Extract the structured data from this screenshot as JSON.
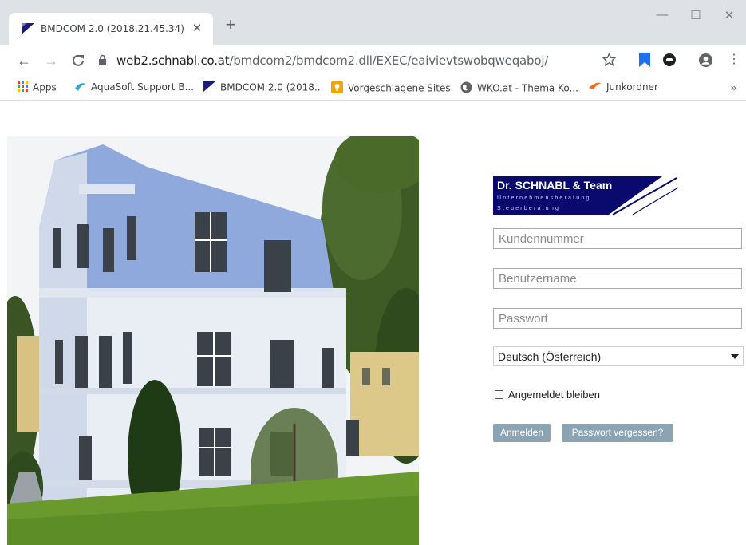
{
  "browser": {
    "tab_title": "BMDCOM 2.0 (2018.21.45.34)",
    "url_host": "web2.schnabl.co.at",
    "url_path": "/bmdcom2/bmdcom2.dll/EXEC/eaivievtswobqweqaboj/",
    "bookmarks": [
      {
        "label": "Apps",
        "icon": "apps-grid-icon"
      },
      {
        "label": "AquaSoft Support B...",
        "icon": "aquasoft-icon"
      },
      {
        "label": "BMDCOM 2.0 (2018...",
        "icon": "bmd-icon"
      },
      {
        "label": "Vorgeschlagene Sites",
        "icon": "suggested-sites-icon"
      },
      {
        "label": "WKO.at - Thema Ko...",
        "icon": "globe-icon"
      },
      {
        "label": "Junkordner",
        "icon": "junkordner-icon"
      }
    ],
    "overflow_label": "»"
  },
  "logo": {
    "title": "Dr. SCHNABL & Team",
    "line1": "Unternehmensberatung",
    "line2": "Steuerberatung",
    "color": "#0a0a6e"
  },
  "login": {
    "customer_placeholder": "Kundennummer",
    "user_placeholder": "Benutzername",
    "password_placeholder": "Passwort",
    "language": "Deutsch (Österreich)",
    "remember_label": "Angemeldet bleiben",
    "login_button": "Anmelden",
    "forgot_button": "Passwort vergessen?",
    "button_color": "#8aa4b4"
  }
}
